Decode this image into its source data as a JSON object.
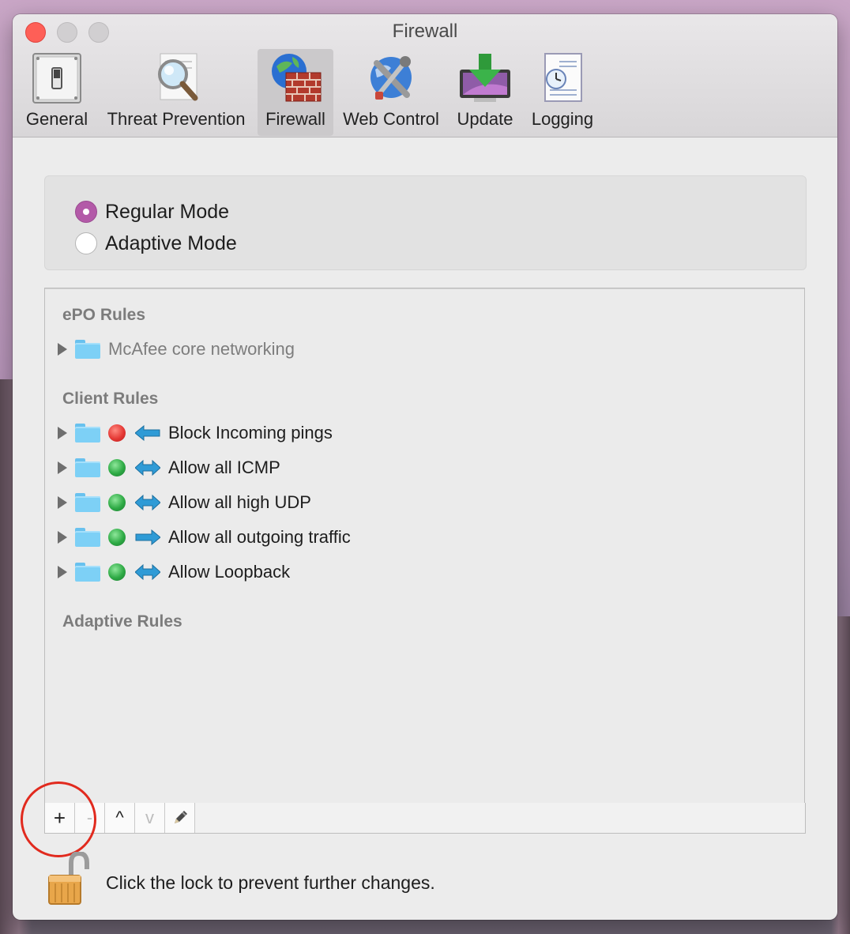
{
  "window": {
    "title": "Firewall"
  },
  "toolbar": {
    "items": [
      {
        "label": "General",
        "icon": "toggle-switch-icon",
        "selected": false
      },
      {
        "label": "Threat Prevention",
        "icon": "magnifier-icon",
        "selected": false
      },
      {
        "label": "Firewall",
        "icon": "globe-brick-wall-icon",
        "selected": true
      },
      {
        "label": "Web Control",
        "icon": "globe-tools-icon",
        "selected": false
      },
      {
        "label": "Update",
        "icon": "download-arrow-icon",
        "selected": false
      },
      {
        "label": "Logging",
        "icon": "clock-document-icon",
        "selected": false
      }
    ]
  },
  "mode": {
    "options": [
      {
        "label": "Regular Mode",
        "selected": true
      },
      {
        "label": "Adaptive Mode",
        "selected": false
      }
    ]
  },
  "rules": {
    "sections": [
      {
        "header": "ePO Rules",
        "items": [
          {
            "label": "McAfee core networking",
            "status": null,
            "direction": null,
            "dimmed": true
          }
        ]
      },
      {
        "header": "Client Rules",
        "items": [
          {
            "label": "Block Incoming pings",
            "status": "blocked",
            "status_color": "#e53935",
            "direction": "incoming"
          },
          {
            "label": "Allow all ICMP",
            "status": "allowed",
            "status_color": "#2eaa45",
            "direction": "both"
          },
          {
            "label": "Allow all high UDP",
            "status": "allowed",
            "status_color": "#2eaa45",
            "direction": "both"
          },
          {
            "label": "Allow all outgoing traffic",
            "status": "allowed",
            "status_color": "#2eaa45",
            "direction": "outgoing"
          },
          {
            "label": "Allow Loopback",
            "status": "allowed",
            "status_color": "#2eaa45",
            "direction": "both"
          }
        ]
      },
      {
        "header": "Adaptive Rules",
        "items": []
      }
    ]
  },
  "buttons": {
    "add": "+",
    "remove": "-",
    "move_up": "^",
    "move_down": "v"
  },
  "lock": {
    "text": "Click the lock to prevent further changes.",
    "icon": "padlock-unlocked-icon"
  },
  "colors": {
    "selected_radio": "#b35aa8",
    "annotation_circle": "#e12a1e",
    "arrow": "#2f9bd6"
  }
}
